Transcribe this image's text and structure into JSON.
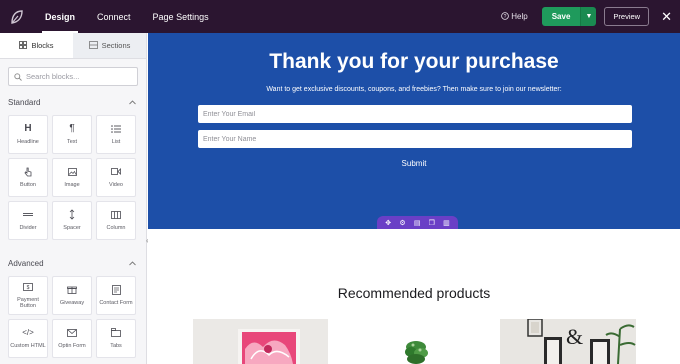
{
  "topbar": {
    "tabs": [
      {
        "label": "Design",
        "active": true
      },
      {
        "label": "Connect",
        "active": false
      },
      {
        "label": "Page Settings",
        "active": false
      }
    ],
    "help_label": "Help",
    "save_label": "Save",
    "preview_label": "Preview"
  },
  "sidebar": {
    "tabs": [
      {
        "label": "Blocks",
        "icon": "grid-icon",
        "active": true
      },
      {
        "label": "Sections",
        "icon": "sections-icon",
        "active": false
      }
    ],
    "search_placeholder": "Search blocks...",
    "groups": [
      {
        "title": "Standard",
        "blocks": [
          {
            "label": "Headline",
            "icon": "heading-icon"
          },
          {
            "label": "Text",
            "icon": "paragraph-icon"
          },
          {
            "label": "List",
            "icon": "list-icon"
          },
          {
            "label": "Button",
            "icon": "hand-pointer-icon"
          },
          {
            "label": "Image",
            "icon": "image-icon"
          },
          {
            "label": "Video",
            "icon": "video-icon"
          },
          {
            "label": "Divider",
            "icon": "divider-icon"
          },
          {
            "label": "Spacer",
            "icon": "spacer-icon"
          },
          {
            "label": "Column",
            "icon": "column-icon"
          }
        ]
      },
      {
        "title": "Advanced",
        "blocks": [
          {
            "label": "Payment Button",
            "icon": "payment-icon"
          },
          {
            "label": "Giveaway",
            "icon": "giveaway-icon"
          },
          {
            "label": "Contact Form",
            "icon": "contact-form-icon"
          },
          {
            "label": "Custom HTML",
            "icon": "code-icon"
          },
          {
            "label": "Optin Form",
            "icon": "optin-icon"
          },
          {
            "label": "Tabs",
            "icon": "tabs-icon"
          }
        ]
      }
    ]
  },
  "canvas": {
    "hero": {
      "title": "Thank you for your purchase",
      "subtitle": "Want to get exclusive discounts, coupons, and freebies? Then make sure to join our newsletter:",
      "email_placeholder": "Enter Your Email",
      "name_placeholder": "Enter Your Name",
      "submit_label": "Submit",
      "background": "#1d4fa8"
    },
    "section_toolbar_icons": [
      "move-icon",
      "settings-icon",
      "save-section-icon",
      "duplicate-icon",
      "delete-icon"
    ],
    "recommended_title": "Recommended products"
  },
  "colors": {
    "topbar": "#2b1530",
    "save": "#1f9a5c",
    "toolbar": "#6a3fc6"
  }
}
